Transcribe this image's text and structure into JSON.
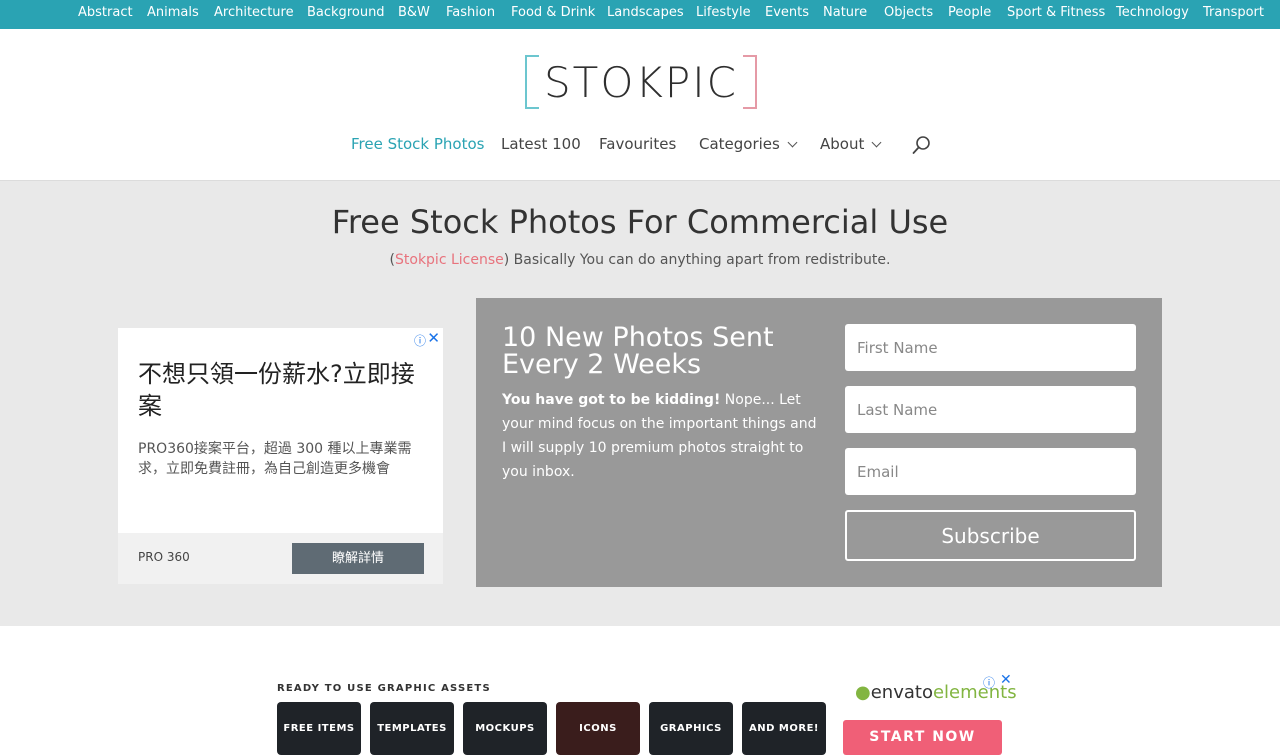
{
  "topbar": {
    "categories": [
      "Abstract",
      "Animals",
      "Architecture",
      "Background",
      "B&W",
      "Fashion",
      "Food & Drink",
      "Landscapes",
      "Lifestyle",
      "Events",
      "Nature",
      "Objects",
      "People",
      "Sport & Fitness",
      "Technology",
      "Transport"
    ],
    "color": "#2aa3b3"
  },
  "header": {
    "logo_text": "STOKPIC",
    "nav": {
      "free_stock_photos": "Free Stock Photos",
      "latest_100": "Latest 100",
      "favourites": "Favourites",
      "categories": "Categories",
      "about": "About"
    },
    "search_icon": "search-icon"
  },
  "hero": {
    "title": "Free Stock Photos For Commercial Use",
    "sub_open": "(",
    "license_link": "Stokpic License",
    "sub_rest": ") Basically You can do anything apart from redistribute."
  },
  "ad1": {
    "choice": "ⓘ",
    "close": "✕",
    "title": "不想只領一份薪水?立即接案",
    "body": "PRO360接案平台，超過 300 種以上專業需求，立即免費註冊，為自己創造更多機會",
    "brand": "PRO 360",
    "cta": "瞭解詳情"
  },
  "newsletter": {
    "title": "10 New Photos Sent Every 2 Weeks",
    "body_bold": "You have got to be kidding!",
    "body_rest": " Nope... Let your mind focus on the important things and I will supply 10 premium photos straight to you inbox.",
    "first_name_placeholder": "First Name",
    "last_name_placeholder": "Last Name",
    "email_placeholder": "Email",
    "subscribe": "Subscribe"
  },
  "ad2": {
    "heading": "READY TO USE GRAPHIC ASSETS",
    "tiles": [
      "FREE ITEMS",
      "TEMPLATES",
      "MOCKUPS",
      "ICONS",
      "GRAPHICS",
      "AND MORE!"
    ],
    "brand_envato": "envato",
    "brand_elements": "elements",
    "choice": "ⓘ",
    "close": "✕",
    "cta": "START NOW"
  }
}
